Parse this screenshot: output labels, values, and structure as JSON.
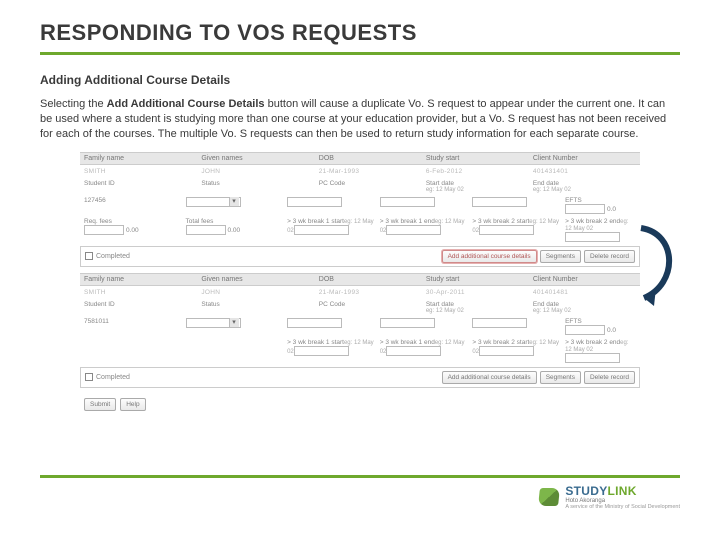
{
  "title": "RESPONDING TO VOS REQUESTS",
  "section_heading": "Adding Additional Course Details",
  "paragraph_pre": "Selecting the ",
  "paragraph_bold": "Add Additional Course Details",
  "paragraph_post": " button will cause a duplicate Vo. S request to appear under the current one. It can be used where a student is studying more than one course at your education provider, but a Vo. S request has not been received for each of the courses. The multiple Vo. S requests can then be used to return study information for each separate course.",
  "form": {
    "headers": {
      "family": "Family name",
      "given": "Given names",
      "dob": "DOB",
      "study_start": "Study start",
      "client_no": "Client Number"
    },
    "records": [
      {
        "family": "SMITH",
        "given": "JOHN",
        "dob": "21-Mar-1993",
        "study_start": "6-Feb-2012",
        "client_no": "401431401"
      },
      {
        "family": "SMITH",
        "given": "JOHN",
        "dob": "21-Mar-1993",
        "study_start": "30-Apr-2011",
        "client_no": "401401481"
      }
    ],
    "row2": {
      "student_id": "Student ID",
      "status": "Status",
      "pc_code": "PC Code",
      "start_date": "Start date",
      "start_hint": "eg: 12 May 02",
      "end_date": "End date",
      "end_hint": "eg: 12 May 02",
      "efts": "EFTS",
      "sid1": "127456",
      "efts1": "0.0",
      "sid2": "7581011",
      "efts2": "0.0"
    },
    "row3": {
      "req_fees": "Req. fees",
      "total_fees": "Total fees",
      "reqv": "0.00",
      "totv": "0.00",
      "b1s": "> 3 wk break 1 start",
      "b1e": "> 3 wk break 1 end",
      "b2s": "> 3 wk break 2 start",
      "b2e": "> 3 wk break 2 end",
      "hint": "eg: 12 May 02"
    },
    "completed": "Completed",
    "buttons": {
      "add": "Add additional course details",
      "seg": "Segments",
      "del": "Delete record",
      "submit": "Submit",
      "help": "Help"
    }
  },
  "brand": {
    "name_a": "STUDY",
    "name_b": "LINK",
    "maori": "Hoto Akoranga",
    "tag": "A service of the Ministry of Social Development"
  }
}
